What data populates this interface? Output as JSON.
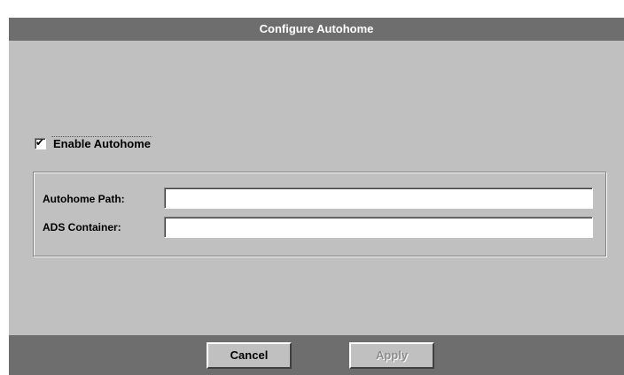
{
  "dialog": {
    "title": "Configure Autohome"
  },
  "enable_autohome": {
    "label": "Enable Autohome",
    "checked": true
  },
  "fields": {
    "autohome_path": {
      "label": "Autohome Path:",
      "value": ""
    },
    "ads_container": {
      "label": "ADS Container:",
      "value": ""
    }
  },
  "buttons": {
    "cancel": "Cancel",
    "apply": "Apply",
    "apply_enabled": false
  },
  "colors": {
    "titlebar_bg": "#6e6e6e",
    "dialog_bg": "#c0c0c0",
    "footer_bg": "#6e6e6e",
    "disabled_text": "#8e8e8e"
  }
}
